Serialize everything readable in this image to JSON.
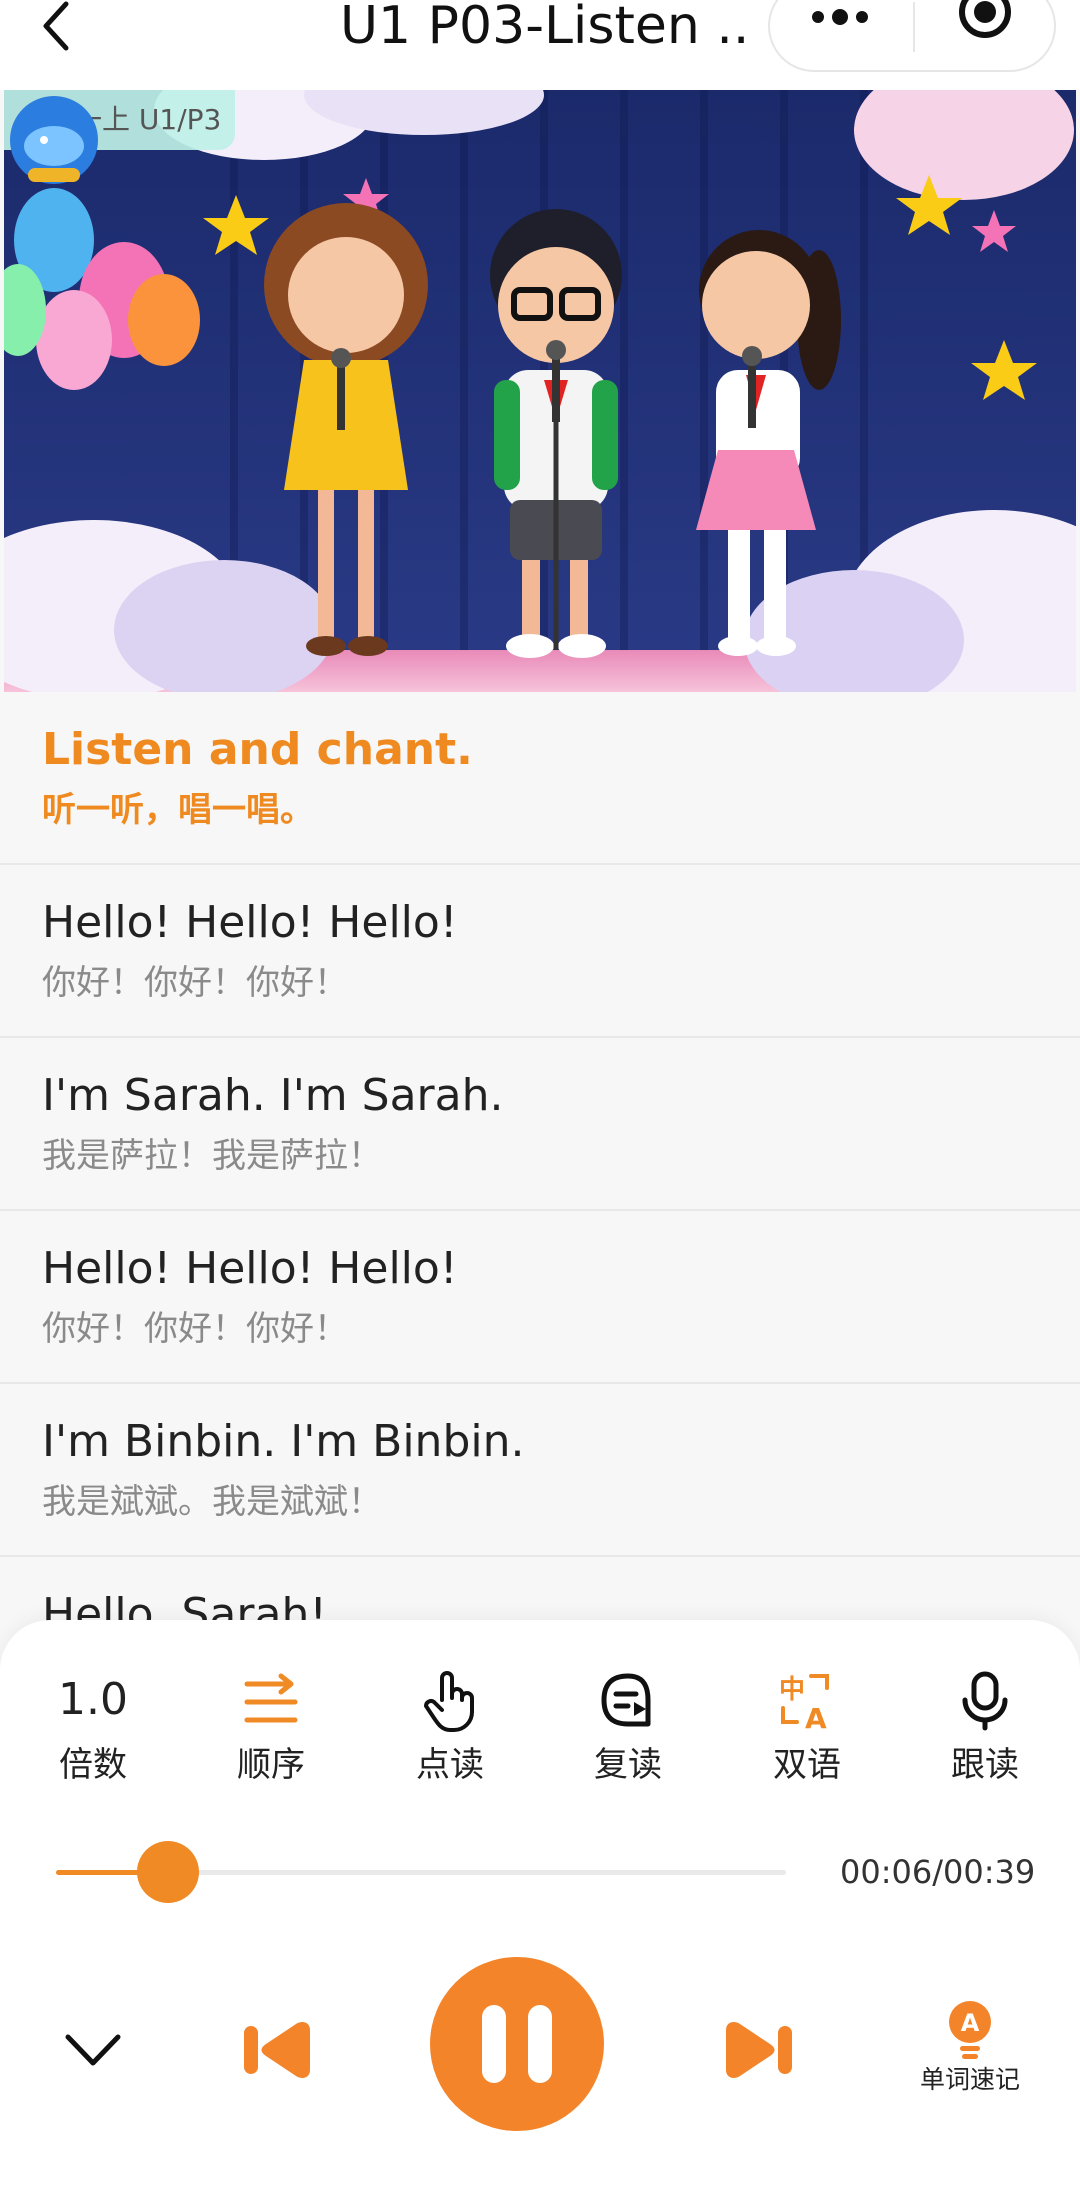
{
  "header": {
    "title": "U1 P03-Listen ..."
  },
  "hero": {
    "tag": "人教一上 U1/P3"
  },
  "lines": [
    {
      "en": "Listen and chant.",
      "zh": "听一听，唱一唱。",
      "active": true
    },
    {
      "en": "Hello! Hello! Hello!",
      "zh": "你好！你好！你好！",
      "active": false
    },
    {
      "en": "I'm Sarah. I'm Sarah.",
      "zh": "我是萨拉！我是萨拉！",
      "active": false
    },
    {
      "en": "Hello! Hello! Hello!",
      "zh": "你好！你好！你好！",
      "active": false
    },
    {
      "en": "I'm Binbin. I'm Binbin.",
      "zh": "我是斌斌。我是斌斌！",
      "active": false
    },
    {
      "en": "Hello, Sarah!",
      "zh": "",
      "active": false
    }
  ],
  "tools": {
    "rate": {
      "value": "1.0",
      "label": "倍数"
    },
    "order": {
      "label": "顺序",
      "icon": "list-order-icon"
    },
    "tap_read": {
      "label": "点读",
      "icon": "hand-pointer-icon"
    },
    "repeat": {
      "label": "复读",
      "icon": "repeat-read-icon"
    },
    "bilingual": {
      "label": "双语",
      "icon": "translate-icon"
    },
    "follow": {
      "label": "跟读",
      "icon": "microphone-icon"
    }
  },
  "player": {
    "progress": 0.154,
    "time": "00:06/00:39",
    "vocab_label": "单词速记",
    "state": "playing"
  },
  "colors": {
    "accent": "#F08A24",
    "text": "#222222",
    "subtext": "#8A8A8A",
    "divider": "#E8E8E8"
  }
}
